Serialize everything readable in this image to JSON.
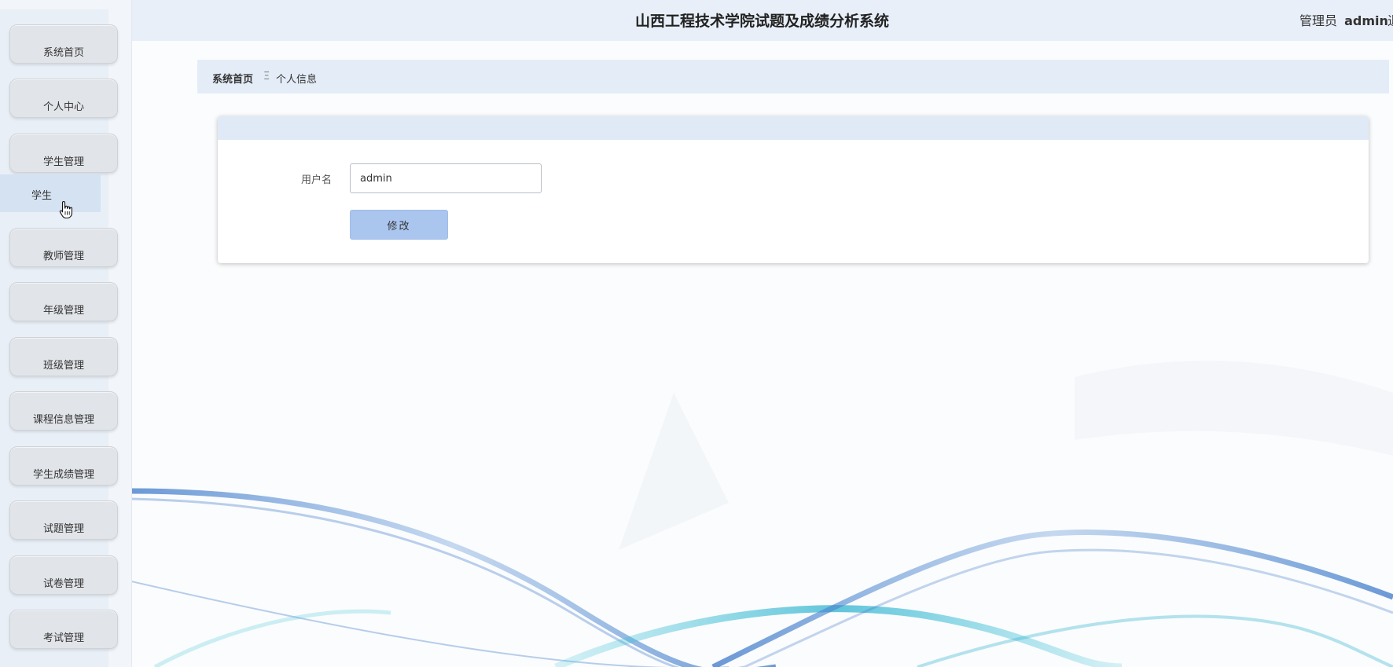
{
  "header": {
    "title": "山西工程技术学院试题及成绩分析系统",
    "user_role": "管理员",
    "user_name": "admin",
    "logout_label": "退"
  },
  "sidebar": {
    "items": [
      {
        "label": "系统首页"
      },
      {
        "label": "个人中心"
      },
      {
        "label": "学生管理"
      },
      {
        "label": "教师管理"
      },
      {
        "label": "年级管理"
      },
      {
        "label": "班级管理"
      },
      {
        "label": "课程信息管理"
      },
      {
        "label": "学生成绩管理"
      },
      {
        "label": "试题管理"
      },
      {
        "label": "试卷管理"
      },
      {
        "label": "考试管理"
      }
    ],
    "submenu": {
      "label": "学生"
    }
  },
  "breadcrumb": {
    "home": "系统首页",
    "separator": "Ξ",
    "current": "个人信息"
  },
  "form": {
    "username_label": "用户名",
    "username_value": "admin",
    "submit_label": "修改"
  },
  "colors": {
    "sidebar_bg": "#f2f5f9",
    "header_bg": "#e8eff8",
    "button_bg": "#aac6ef",
    "wave_blue": "#3b78c9",
    "wave_cyan": "#3cc2d8"
  },
  "icons": {
    "cursor": "hand-pointer-icon"
  }
}
